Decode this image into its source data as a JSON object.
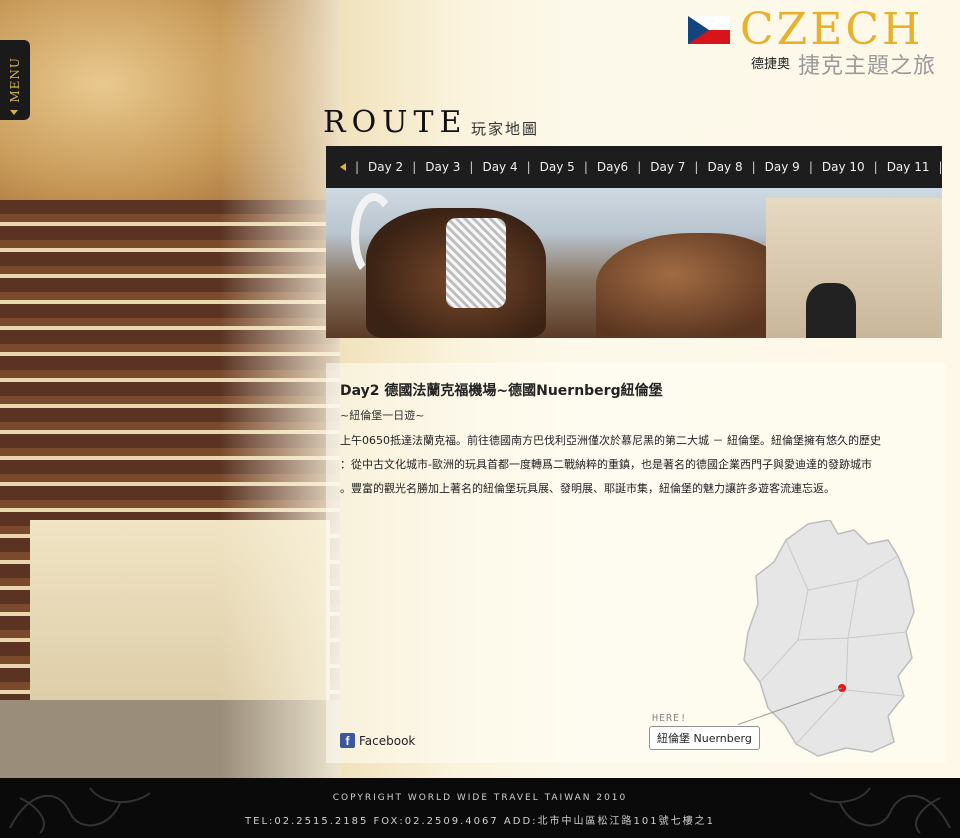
{
  "menu": {
    "label": "MENU"
  },
  "brand": {
    "title": "CZECH",
    "subtitle_small": "德捷奧",
    "subtitle_large": "捷克主題之旅"
  },
  "route": {
    "title": "ROUTE",
    "subtitle": "玩家地圖"
  },
  "day_nav": {
    "items": [
      "Day 2",
      "Day 3",
      "Day 4",
      "Day 5",
      "Day6",
      "Day 7",
      "Day 8",
      "Day 9",
      "Day 10",
      "Day 11"
    ]
  },
  "article": {
    "title": "Day2 德國法蘭克福機場~德國Nuernberg紐倫堡",
    "subtitle": "~紐倫堡一日遊~",
    "body_lines": [
      "上午0650抵達法蘭克福。前往德國南方巴伐利亞洲僅次於慕尼黑的第二大城 － 紐倫堡。紐倫堡擁有悠久的歷史",
      "：從中古文化城市-歐洲的玩具首都一度轉爲二戰納粹的重鎮，也是著名的德國企業西門子與愛迪達的發跡城市",
      "。豐富的觀光名勝加上著名的紐倫堡玩具展、發明展、耶誕市集，紐倫堡的魅力讓許多遊客流連忘返。"
    ]
  },
  "map": {
    "here_label": "HERE!",
    "location_label": "紐倫堡 Nuernberg"
  },
  "social": {
    "facebook_icon_letter": "f",
    "facebook_label": "Facebook"
  },
  "footer": {
    "copyright": "COPYRIGHT  WORLD WIDE TRAVEL TAIWAN 2010",
    "contact": "TEL:02.2515.2185 FOX:02.2509.4067 ADD:北市中山區松江路101號七樓之1"
  },
  "colors": {
    "accent_gold": "#e7b12b",
    "nav_bg": "#1d1d1d",
    "footer_bg": "#0a0a0a",
    "map_dot": "#e11b1b"
  },
  "icons": [
    "menu-arrow-icon",
    "prev-arrow-icon",
    "next-arrow-icon",
    "czech-flag-icon",
    "facebook-icon",
    "map-location-dot-icon"
  ]
}
